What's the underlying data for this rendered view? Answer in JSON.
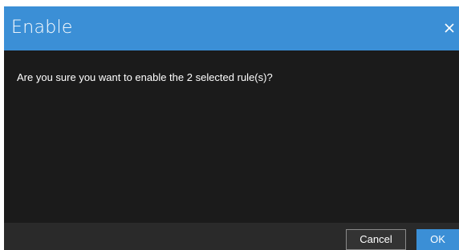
{
  "dialog": {
    "title": "Enable",
    "close_icon": "close-icon",
    "message": "Are you sure you want to enable the 2 selected rule(s)?",
    "buttons": {
      "cancel_label": "Cancel",
      "ok_label": "OK"
    }
  },
  "colors": {
    "header_bg": "#3b8fd6",
    "body_bg": "#1b1b1b",
    "footer_bg": "#2a2a2a",
    "primary_button": "#3b8fd6",
    "text": "#ffffff"
  }
}
